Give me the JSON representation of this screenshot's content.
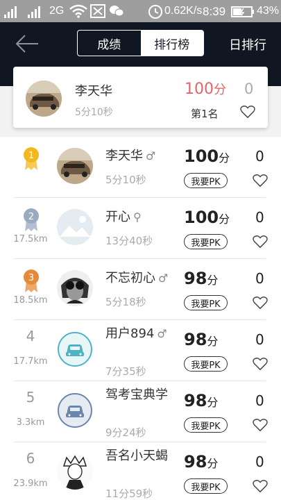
{
  "status_bar": {
    "network": "2G",
    "speed": "0.62K/s",
    "time": "8:39",
    "battery": "43%"
  },
  "nav": {
    "tabs": [
      {
        "label": "成绩",
        "active": false
      },
      {
        "label": "排行榜",
        "active": true
      }
    ],
    "daily_label": "日排行"
  },
  "my_card": {
    "name": "李天华",
    "time": "5分10秒",
    "score": "100",
    "score_unit": "分",
    "likes": "0",
    "rank": "第1名",
    "avatar": "car-photo"
  },
  "pk_label": "我要PK",
  "score_unit": "分",
  "colors": {
    "navbar": "#101722",
    "my_score": "#e0646a",
    "gold": "#f2b81e",
    "silver": "#9aaac0",
    "bronze": "#e58a3a",
    "car_icon": "#4fb3c5",
    "car_icon_blue": "#6b86ad"
  },
  "rankings": [
    {
      "rank": "1",
      "medal": "gold",
      "distance": "",
      "name": "李天华",
      "gender": "♂",
      "time": "5分10秒",
      "score": "100",
      "likes": "0",
      "avatar": "car-photo"
    },
    {
      "rank": "2",
      "medal": "silver",
      "distance": "17.5km",
      "name": "开心",
      "gender": "⚲",
      "time": "13分40秒",
      "score": "100",
      "likes": "0",
      "avatar": "default-landscape"
    },
    {
      "rank": "3",
      "medal": "bronze",
      "distance": "18.5km",
      "name": "不忘初心",
      "gender": "♂",
      "time": "5分18秒",
      "score": "98",
      "likes": "0",
      "avatar": "aviator-portrait"
    },
    {
      "rank": "4",
      "medal": "",
      "distance": "17.7km",
      "name": "用户894",
      "gender": "♂",
      "time": "7分35秒",
      "score": "98",
      "likes": "0",
      "avatar": "teal-car-icon"
    },
    {
      "rank": "5",
      "medal": "",
      "distance": "3.3km",
      "name": "驾考宝典学",
      "gender": "",
      "time": "9分24秒",
      "score": "98",
      "likes": "0",
      "avatar": "blue-car-icon"
    },
    {
      "rank": "6",
      "medal": "",
      "distance": "23.9km",
      "name": "吾名小天蝎",
      "gender": "",
      "time": "11分59秒",
      "score": "98",
      "likes": "0",
      "avatar": "anime-sketch"
    }
  ]
}
